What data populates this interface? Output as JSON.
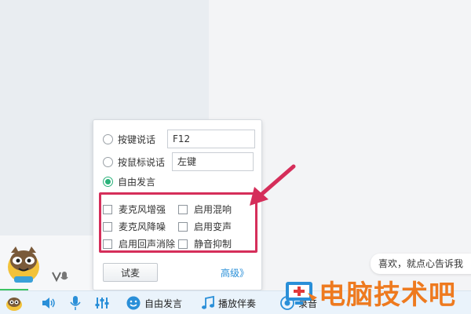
{
  "voice_mode": {
    "options": [
      {
        "label": "按键说话",
        "value": "F12",
        "selected": false
      },
      {
        "label": "按鼠标说话",
        "value": "左键",
        "selected": false
      },
      {
        "label": "自由发言",
        "selected": true
      }
    ]
  },
  "audio_options": {
    "left": [
      {
        "label": "麦克风增强",
        "checked": false
      },
      {
        "label": "麦克风降噪",
        "checked": false
      },
      {
        "label": "启用回声消除",
        "checked": false
      }
    ],
    "right": [
      {
        "label": "启用混响",
        "checked": false
      },
      {
        "label": "启用变声",
        "checked": false
      },
      {
        "label": "静音抑制",
        "checked": false
      }
    ]
  },
  "buttons": {
    "test_mic": "试麦",
    "advanced": "高级》"
  },
  "toolbar": {
    "free_speech": "自由发言",
    "play_accompaniment": "播放伴奏",
    "record_partial": "录音"
  },
  "chat": {
    "bubble_text": "喜欢，就点心告诉我"
  },
  "watermark": {
    "text": "电脑技术吧"
  },
  "colors": {
    "accent_green": "#2bb27a",
    "highlight_red": "#d52e5a",
    "link_blue": "#2a8fd8",
    "watermark_orange": "#ee7a1f"
  },
  "icons": [
    "mascot-icon",
    "mic-status-icon",
    "volume-icon",
    "microphone-icon",
    "equalizer-icon",
    "smiley-icon",
    "music-note-icon",
    "record-icon",
    "arrow-annotation-icon"
  ]
}
